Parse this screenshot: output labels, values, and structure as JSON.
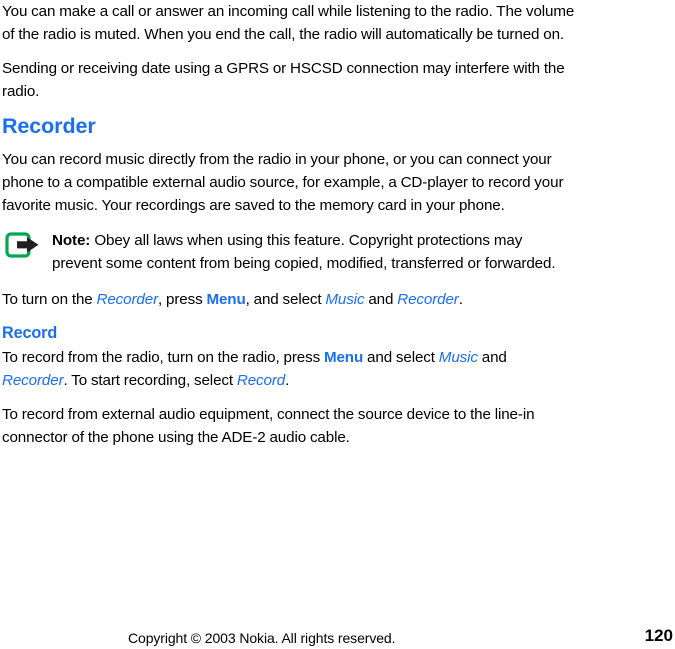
{
  "document": {
    "type": "user-guide-page",
    "accent_color": "#1a6fef",
    "text_color": "#000000",
    "background_color": "#ffffff"
  },
  "body": {
    "paragraph_1": "You can make a call or answer an incoming call while listening to the radio. The volume of the radio is muted. When you end the call, the radio will automatically be turned on.",
    "paragraph_2": "Sending or receiving date using a GPRS or HSCSD connection may interfere with the radio.",
    "paragraph_3": "You can record music directly from the radio in your phone, or you can connect your phone to a compatible external audio source, for example, a CD-player to record your favorite music. Your recordings are saved to the memory card in your phone.",
    "paragraph_external": "To record from external audio equipment, connect the source device to the line-in connector of the phone using the ADE-2 audio cable."
  },
  "headings": {
    "section": "Recorder",
    "subsection": "Record"
  },
  "note": {
    "icon": "note-arrow-icon",
    "icon_border_color": "#00a651",
    "icon_arrow_color": "#231f20",
    "label": "Note:",
    "text": " Obey all laws when using this feature.  Copyright protections may prevent some content from being copied, modified, transferred or forwarded."
  },
  "turn_on": {
    "part_1": "To turn on the ",
    "ref_recorder_1": "Recorder",
    "part_2": ", press ",
    "ref_menu": "Menu",
    "part_3": ", and select ",
    "ref_music": "Music",
    "part_4": " and ",
    "ref_recorder_2": "Recorder",
    "part_5": "."
  },
  "record_from_radio": {
    "part_1": "To record from the radio, turn on the radio, press ",
    "ref_menu": "Menu",
    "part_2": " and select ",
    "ref_music": "Music",
    "part_3": " and ",
    "ref_recorder": "Recorder",
    "part_4": ". To start recording, select ",
    "ref_record": "Record",
    "part_5": "."
  },
  "footer": {
    "copyright": "Copyright © 2003 Nokia. All rights reserved.",
    "page_number": "120"
  }
}
